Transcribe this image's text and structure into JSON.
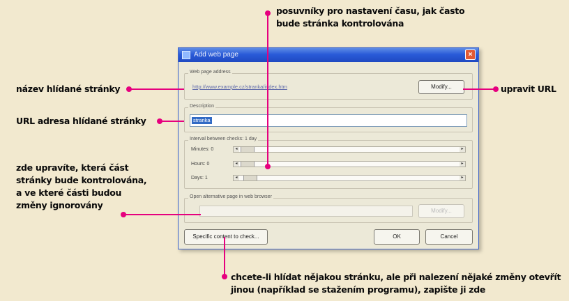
{
  "annotations": {
    "top_line1": "posuvníky pro nastavení času, jak často",
    "top_line2": "bude stránka kontrolována",
    "name": "název hlídané stránky",
    "url": "URL adresa hlídané stránky",
    "modify_line1": "zde upravíte, která část",
    "modify_line2": "stránky bude kontrolována,",
    "modify_line3": "a ve které části budou",
    "modify_line4": "změny ignorovány",
    "edit_url": "upravit URL",
    "bottom_line1": "chcete-li hlídat nějakou stránku, ale při nalezení nějaké změny otevřít",
    "bottom_line2": "jinou (například se stažením programu), zapište ji zde"
  },
  "dialog": {
    "title": "Add web page",
    "url_group_label": "Web page address",
    "url_value": "http://www.example.cz/stranka/index.htm",
    "modify_button": "Modify...",
    "description_label": "Description",
    "description_value": "stranka",
    "interval_label": "Interval between checks: 1 day",
    "minutes_label": "Minutes: 0",
    "hours_label": "Hours: 0",
    "days_label": "Days: 1",
    "alt_group_label": "Open alternative page in web browser",
    "alt_button": "Modify...",
    "specific_button": "Specific content to check...",
    "ok_button": "OK",
    "cancel_button": "Cancel",
    "close_glyph": "×",
    "arrow_left": "◂",
    "arrow_right": "▸"
  },
  "colors": {
    "accent": "#e6007e",
    "background": "#f2e9cf",
    "titlebar": "#2a5bd8"
  }
}
